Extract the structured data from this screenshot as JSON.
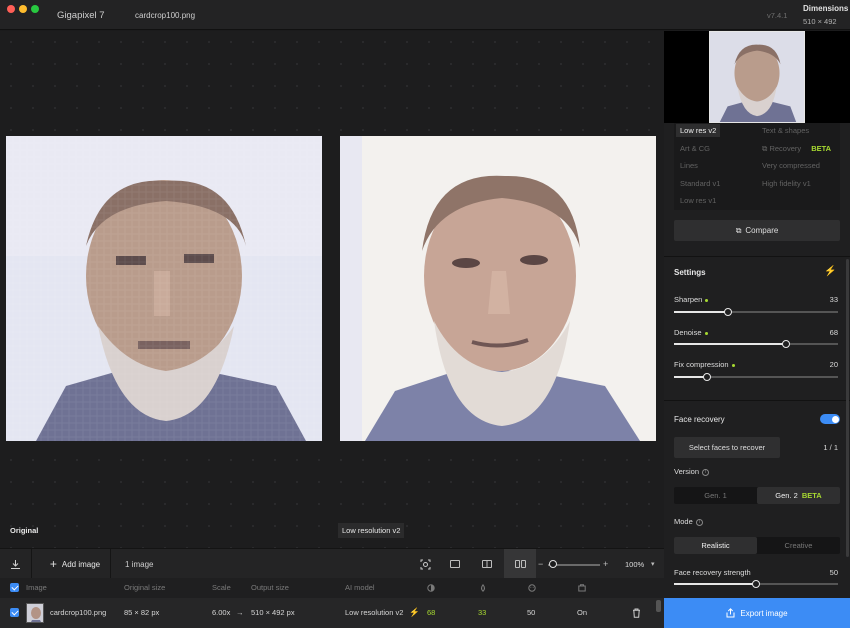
{
  "window": {
    "app_name": "Gigapixel 7",
    "file_tab": "cardcrop100.png",
    "version": "v7.4.1",
    "dimensions_label": "Dimensions",
    "dimensions_value": "510 × 492",
    "traffic_colors": [
      "#ff5f57",
      "#febc2e",
      "#28c840"
    ]
  },
  "canvas": {
    "left_label": "Original",
    "right_label": "Low resolution v2"
  },
  "toolbar": {
    "add_image": "Add image",
    "image_count": "1 image",
    "zoom_minus": "−",
    "zoom_plus": "+",
    "zoom_level": "100%"
  },
  "table": {
    "headers": [
      "Image",
      "Original size",
      "Scale",
      "Output size",
      "AI model"
    ],
    "row": {
      "filename": "cardcrop100.png",
      "original_size": "85 × 82 px",
      "scale": "6.00x",
      "arrow": "→",
      "output_size": "510 × 492 px",
      "model": "Low resolution v2",
      "sharpen": "68",
      "denoise": "33",
      "face": "50",
      "face_state": "On"
    }
  },
  "sidebar": {
    "models": {
      "low_res_v2": "Low res v2",
      "text_shapes": "Text & shapes",
      "art_cg": "Art & CG",
      "recovery": "Recovery",
      "beta": "BETA",
      "lines": "Lines",
      "very_compressed": "Very compressed",
      "standard_v1": "Standard v1",
      "high_fidelity_v1": "High fidelity v1",
      "low_res_v1": "Low res v1"
    },
    "compare": "Compare",
    "settings_title": "Settings",
    "sliders": [
      {
        "label": "Sharpen",
        "value": "33",
        "fraction": 0.33
      },
      {
        "label": "Denoise",
        "value": "68",
        "fraction": 0.68
      },
      {
        "label": "Fix compression",
        "value": "20",
        "fraction": 0.2
      }
    ],
    "face_recovery": {
      "title": "Face recovery",
      "select_faces": "Select faces to recover",
      "face_count": "1 / 1",
      "version_label": "Version",
      "gen1": "Gen. 1",
      "gen2": "Gen. 2",
      "gen2_badge": "BETA",
      "mode_label": "Mode",
      "realistic": "Realistic",
      "creative": "Creative",
      "strength_label": "Face recovery strength",
      "strength_value": "50",
      "strength_fraction": 0.5
    },
    "export": "Export image"
  },
  "colors": {
    "accent_blue": "#3c8cf5",
    "accent_green": "#a7d931"
  }
}
